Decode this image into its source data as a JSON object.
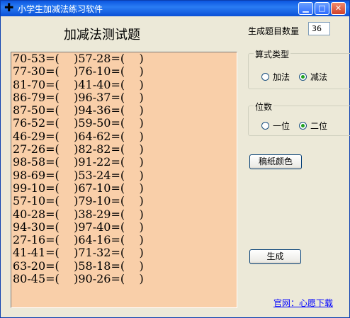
{
  "window": {
    "title": "小学生加减法练习软件"
  },
  "header": {
    "title": "加减法测试题"
  },
  "settings": {
    "count_label": "生成题目数量",
    "count_value": "36",
    "formula_group": {
      "title": "算式类型",
      "add": "加法",
      "sub": "减法",
      "selected": "sub"
    },
    "digit_group": {
      "title": "位数",
      "one": "一位",
      "two": "二位",
      "selected": "two"
    },
    "paper_color_button": "稿纸颜色",
    "generate_button": "生成",
    "link": "官网：心愿下载"
  },
  "colors": {
    "paper": "#f9cfa9",
    "title_bar": "#0a50d6"
  },
  "problems": [
    [
      "70-53=(    )",
      "57-28=(    )"
    ],
    [
      "77-30=(    )",
      "76-10=(    )"
    ],
    [
      "81-70=(    )",
      "41-40=(    )"
    ],
    [
      "86-79=(    )",
      "96-37=(    )"
    ],
    [
      "87-50=(    )",
      "94-36=(    )"
    ],
    [
      "76-52=(    )",
      "59-50=(    )"
    ],
    [
      "46-29=(    )",
      "64-62=(    )"
    ],
    [
      "27-26=(    )",
      "82-82=(    )"
    ],
    [
      "98-58=(    )",
      "91-22=(    )"
    ],
    [
      "98-69=(    )",
      "53-24=(    )"
    ],
    [
      "99-10=(    )",
      "67-10=(    )"
    ],
    [
      "57-10=(    )",
      "79-10=(    )"
    ],
    [
      "40-28=(    )",
      "38-29=(    )"
    ],
    [
      "94-30=(    )",
      "97-40=(    )"
    ],
    [
      "27-16=(    )",
      "64-16=(    )"
    ],
    [
      "41-41=(    )",
      "71-32=(    )"
    ],
    [
      "63-20=(    )",
      "58-18=(    )"
    ],
    [
      "80-45=(    )",
      "90-26=(    )"
    ]
  ]
}
